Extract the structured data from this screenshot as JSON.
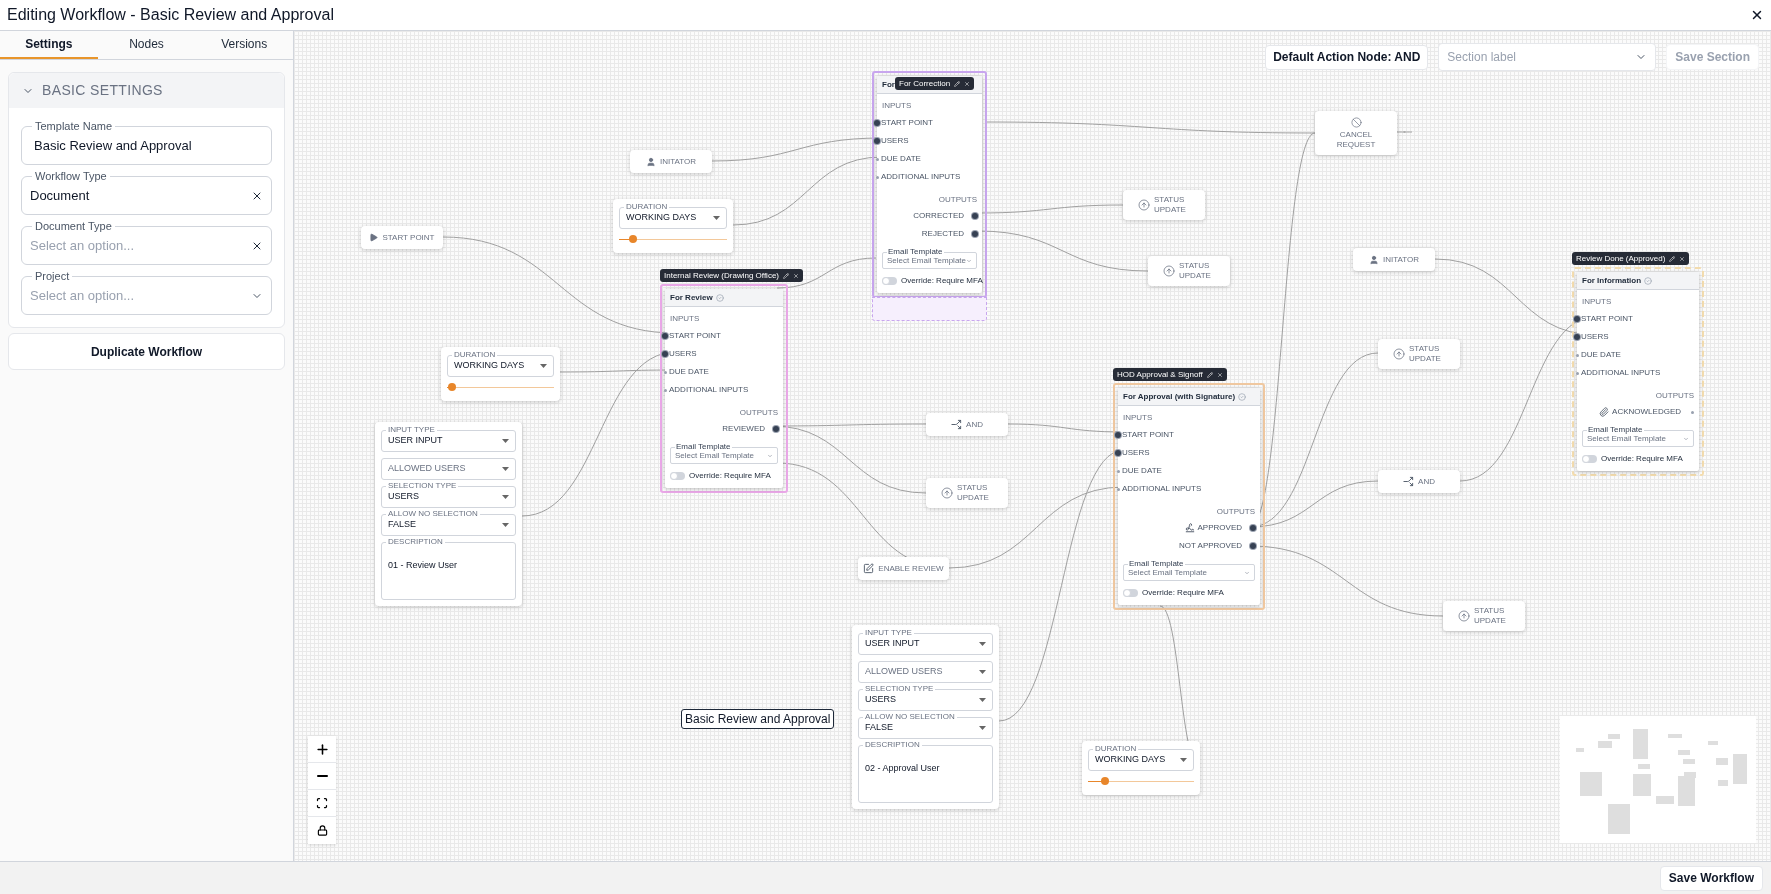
{
  "window": {
    "title": "Editing Workflow - Basic Review and Approval"
  },
  "sidebar": {
    "tabs": [
      {
        "label": "Settings",
        "selected": true
      },
      {
        "label": "Nodes",
        "selected": false
      },
      {
        "label": "Versions",
        "selected": false
      }
    ],
    "section": {
      "title": "BASIC SETTINGS",
      "expanded": true
    },
    "fields": [
      {
        "kind": "text",
        "label": "Template Name",
        "value": "Basic Review and Approval"
      },
      {
        "kind": "clearable",
        "label": "Workflow Type",
        "value": "Document"
      },
      {
        "kind": "clearable",
        "label": "Document Type",
        "placeholder": "Select an option..."
      },
      {
        "kind": "select",
        "label": "Project",
        "placeholder": "Select an option..."
      }
    ],
    "duplicate_button": "Duplicate Workflow"
  },
  "toolbar": {
    "default_action": "Default Action Node: AND",
    "section_select": {
      "placeholder": "Section label"
    },
    "save_section": {
      "label": "Save Section",
      "disabled": true
    }
  },
  "canvas": {
    "nodes": [
      {
        "kind": "start",
        "label": "START POINT"
      },
      {
        "kind": "initiator",
        "label": "INITATOR"
      },
      {
        "kind": "duration",
        "label": "DURATION",
        "value": "WORKING DAYS",
        "level": 0.13
      },
      {
        "kind": "step",
        "tag": "For Correction",
        "title": "For",
        "color": "#c8a6ee",
        "dashed": false,
        "drop_zone": true,
        "inputs_heading": "INPUTS",
        "inputs": [
          {
            "label": "START POINT",
            "connected": true
          },
          {
            "label": "USERS",
            "connected": true
          },
          {
            "label": "DUE DATE",
            "connected": false
          },
          {
            "label": "ADDITIONAL INPUTS",
            "connected": false
          }
        ],
        "outputs_heading": "OUTPUTS",
        "outputs": [
          {
            "kind": "plain",
            "label": "CORRECTED",
            "connected": true
          },
          {
            "kind": "plain",
            "label": "REJECTED",
            "connected": true
          }
        ],
        "email_template": {
          "label": "Email Template",
          "placeholder": "Select Email Template"
        },
        "override": {
          "label": "Override: Require MFA",
          "on": false
        }
      },
      {
        "kind": "status",
        "label": "STATUS UPDATE"
      },
      {
        "kind": "status",
        "label": "STATUS UPDATE"
      },
      {
        "kind": "cancel",
        "label": "CANCEL REQUEST"
      },
      {
        "kind": "initiator",
        "label": "INITATOR"
      },
      {
        "kind": "step",
        "tag": "Internal Review (Drawing Office)",
        "title": "For Review",
        "color": "#eaa8e8",
        "dashed": false,
        "inputs_heading": "INPUTS",
        "inputs": [
          {
            "label": "START POINT",
            "connected": true
          },
          {
            "label": "USERS",
            "connected": true
          },
          {
            "label": "DUE DATE",
            "connected": false
          },
          {
            "label": "ADDITIONAL INPUTS",
            "connected": false
          }
        ],
        "outputs_heading": "OUTPUTS",
        "outputs": [
          {
            "kind": "plain",
            "label": "REVIEWED",
            "connected": true
          }
        ],
        "email_template": {
          "label": "Email Template",
          "placeholder": "Select Email Template"
        },
        "override": {
          "label": "Override: Require MFA",
          "on": false
        }
      },
      {
        "kind": "duration",
        "label": "DURATION",
        "value": "WORKING DAYS",
        "level": 0.05
      },
      {
        "kind": "user_input",
        "fields": [
          {
            "label": "INPUT TYPE",
            "value": "USER INPUT"
          },
          {
            "placeholder": "ALLOWED USERS"
          },
          {
            "label": "SELECTION TYPE",
            "value": "USERS"
          },
          {
            "label": "ALLOW NO SELECTION",
            "value": "FALSE"
          }
        ],
        "description": {
          "label": "DESCRIPTION",
          "value": "01 - Review User"
        }
      },
      {
        "kind": "and",
        "label": "AND"
      },
      {
        "kind": "status",
        "label": "STATUS UPDATE"
      },
      {
        "kind": "enable",
        "label": "ENABLE REVIEW"
      },
      {
        "kind": "step",
        "tag": "HOD Approval & Signoff",
        "title": "For Approval (with Signature)",
        "color": "#f0c8a0",
        "dashed": false,
        "inputs_heading": "INPUTS",
        "inputs": [
          {
            "label": "START POINT",
            "connected": true
          },
          {
            "label": "USERS",
            "connected": true
          },
          {
            "label": "DUE DATE",
            "connected": false
          },
          {
            "label": "ADDITIONAL INPUTS",
            "connected": false
          }
        ],
        "outputs_heading": "OUTPUTS",
        "outputs": [
          {
            "kind": "signature",
            "label": "APPROVED",
            "connected": true
          },
          {
            "kind": "plain",
            "label": "NOT APPROVED",
            "connected": true
          }
        ],
        "email_template": {
          "label": "Email Template",
          "placeholder": "Select Email Template"
        },
        "override": {
          "label": "Override: Require MFA",
          "on": false
        }
      },
      {
        "kind": "status",
        "label": "STATUS UPDATE"
      },
      {
        "kind": "and",
        "label": "AND"
      },
      {
        "kind": "step",
        "tag": "Review Done (Approved)",
        "title": "For Information",
        "color": "#f3dcae",
        "dashed": true,
        "inputs_heading": "INPUTS",
        "inputs": [
          {
            "label": "START POINT",
            "connected": true
          },
          {
            "label": "USERS",
            "connected": true
          },
          {
            "label": "DUE DATE",
            "connected": false
          },
          {
            "label": "ADDITIONAL INPUTS",
            "connected": false
          }
        ],
        "outputs_heading": "OUTPUTS",
        "outputs": [
          {
            "kind": "attachment",
            "label": "ACKNOWLEDGED",
            "connected": false
          }
        ],
        "email_template": {
          "label": "Email Template",
          "placeholder": "Select Email Template"
        },
        "override": {
          "label": "Override: Require MFA",
          "on": false
        }
      },
      {
        "kind": "status",
        "label": "STATUS UPDATE"
      },
      {
        "kind": "user_input",
        "fields": [
          {
            "label": "INPUT TYPE",
            "value": "USER INPUT"
          },
          {
            "placeholder": "ALLOWED USERS"
          },
          {
            "label": "SELECTION TYPE",
            "value": "USERS"
          },
          {
            "label": "ALLOW NO SELECTION",
            "value": "FALSE"
          }
        ],
        "description": {
          "label": "DESCRIPTION",
          "value": "02 - Approval User"
        }
      },
      {
        "kind": "duration",
        "label": "DURATION",
        "value": "WORKING DAYS",
        "level": 0.16
      }
    ],
    "label": "Basic Review and Approval"
  },
  "footer": {
    "save_button": "Save Workflow"
  }
}
